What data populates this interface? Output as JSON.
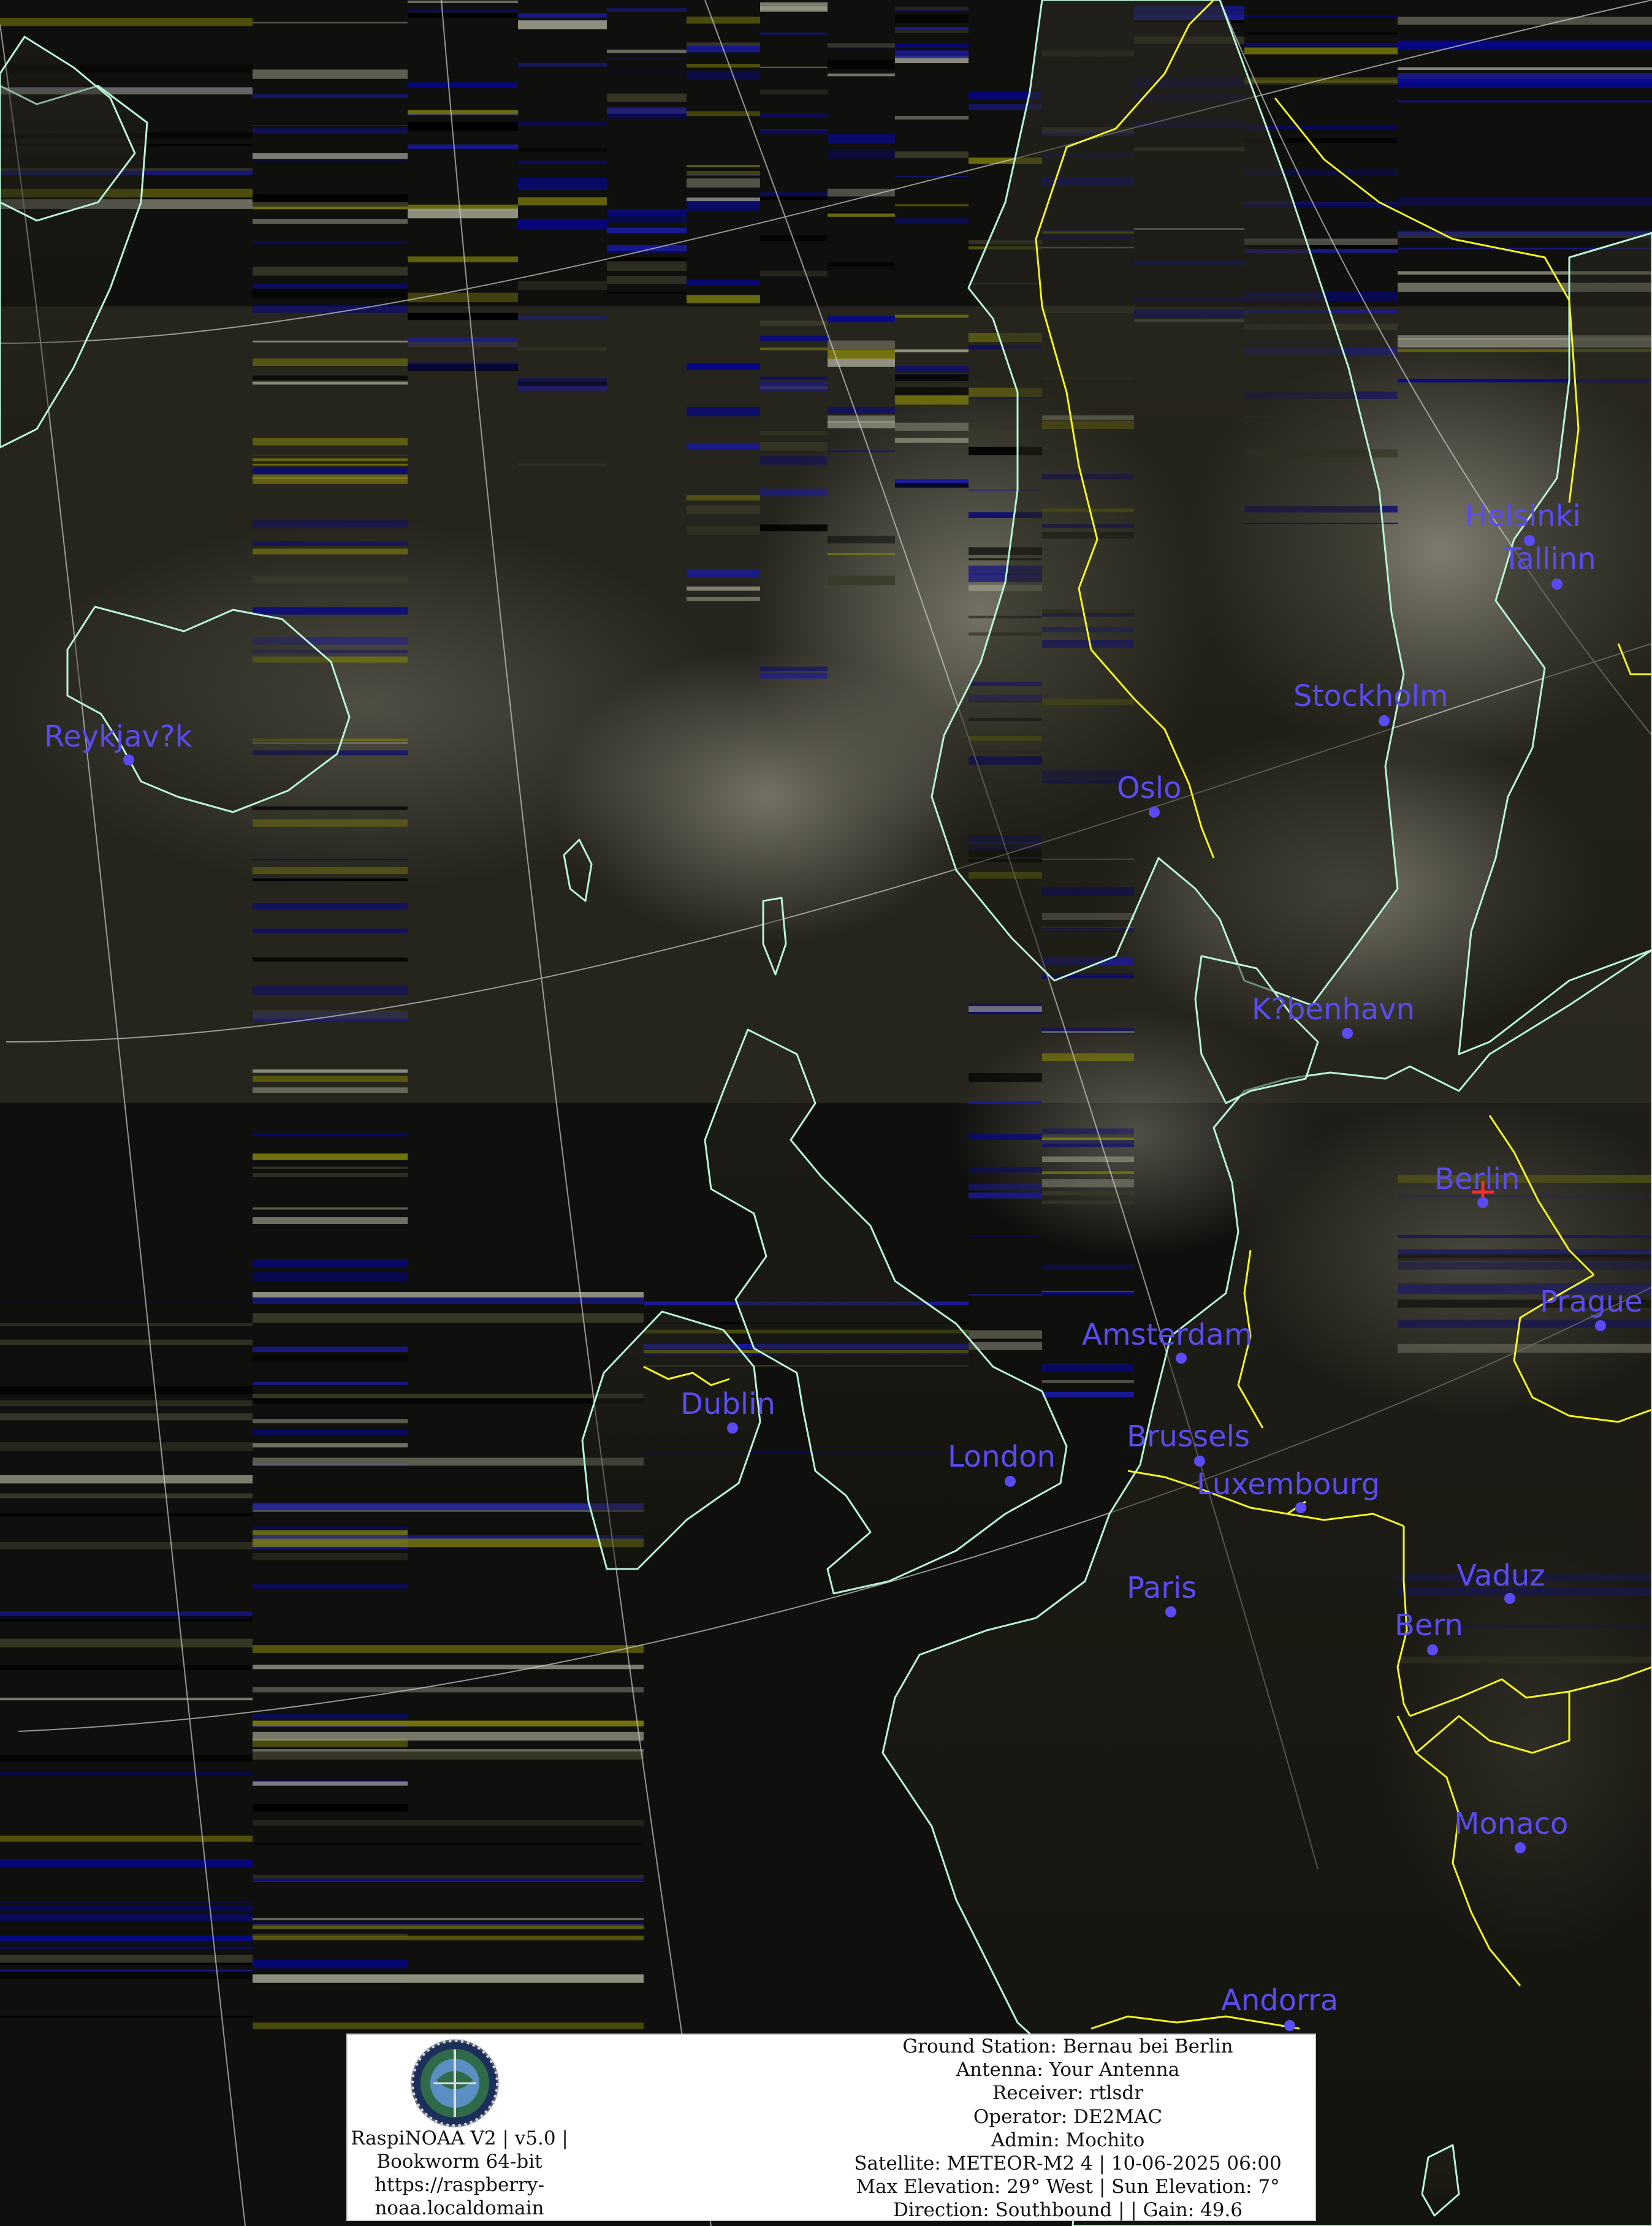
{
  "colors": {
    "coastline": "#b9f3d6",
    "border": "#f5f51e",
    "city": "#5a4cf2",
    "grid": "#cfcfcf",
    "station_marker": "#ff2a2a",
    "noise_blue": "#0a0a8a",
    "noise_yellow": "#8a8a10"
  },
  "cities": [
    {
      "name": "Helsinki"
    },
    {
      "name": "Tallinn"
    },
    {
      "name": "Stockholm"
    },
    {
      "name": "Reykjav?k"
    },
    {
      "name": "Oslo"
    },
    {
      "name": "K?benhavn"
    },
    {
      "name": "Berlin"
    },
    {
      "name": "Prague"
    },
    {
      "name": "Amsterdam"
    },
    {
      "name": "Dublin"
    },
    {
      "name": "London"
    },
    {
      "name": "Brussels"
    },
    {
      "name": "Luxembourg"
    },
    {
      "name": "Paris"
    },
    {
      "name": "Vaduz"
    },
    {
      "name": "Bern"
    },
    {
      "name": "Monaco"
    },
    {
      "name": "Andorra"
    }
  ],
  "info_panel": {
    "logo_icon": "raspinoaa-logo-icon",
    "software": [
      "RaspiNOAA V2 | v5.0 |",
      "Bookworm 64-bit",
      "https://raspberry-",
      "noaa.localdomain"
    ],
    "ground_station": "Ground Station: Bernau bei Berlin",
    "antenna": "Antenna: Your Antenna",
    "receiver": "Receiver: rtlsdr",
    "operator": "Operator: DE2MAC",
    "admin": "Admin: Mochito",
    "satellite": "Satellite: METEOR-M2 4 | 10-06-2025 06:00",
    "elevation": "Max Elevation: 29° West | Sun Elevation: 7°",
    "direction": "Direction: Southbound | | Gain: 49.6"
  }
}
